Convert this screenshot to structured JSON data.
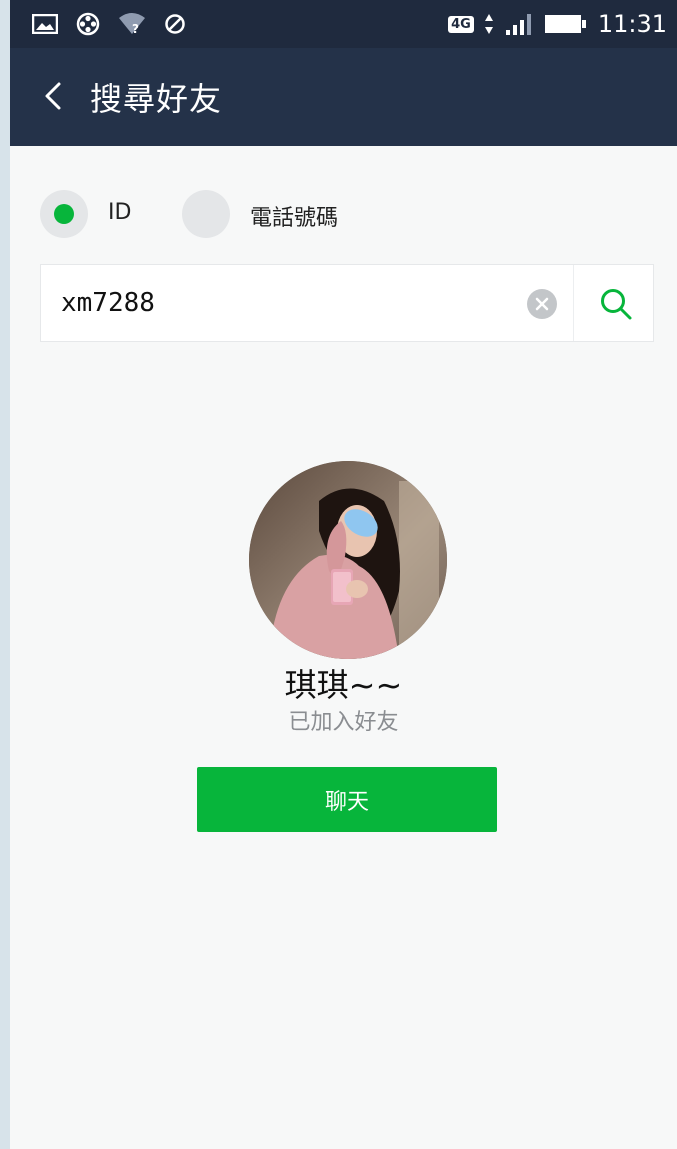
{
  "status_bar": {
    "network": "4G",
    "time": "11:31",
    "icons": [
      "image-icon",
      "film-reel-icon",
      "wifi-question-icon",
      "no-sign-icon",
      "signal-icon",
      "battery-icon"
    ]
  },
  "header": {
    "title": "搜尋好友",
    "back_icon": "chevron-left-icon"
  },
  "search_type": {
    "options": [
      {
        "label": "ID",
        "selected": true
      },
      {
        "label": "電話號碼",
        "selected": false
      }
    ]
  },
  "search": {
    "value": "xm7288",
    "clear_icon": "clear-icon",
    "search_icon": "search-icon"
  },
  "result": {
    "name": "琪琪~~",
    "status": "已加入好友",
    "chat_label": "聊天"
  },
  "colors": {
    "accent_green": "#07b53b",
    "header_bg": "#243249",
    "statusbar_bg": "#1f2a3e",
    "page_bg": "#f7f8f8"
  }
}
